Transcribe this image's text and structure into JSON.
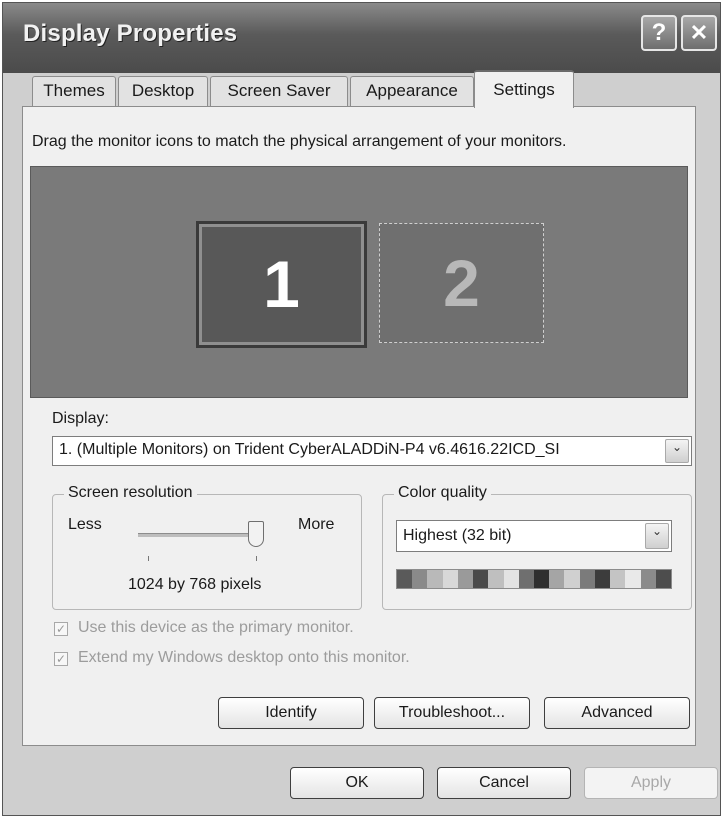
{
  "window": {
    "title": "Display Properties",
    "help_glyph": "?",
    "close_glyph": "✕"
  },
  "tabs": [
    {
      "label": "Themes"
    },
    {
      "label": "Desktop"
    },
    {
      "label": "Screen Saver"
    },
    {
      "label": "Appearance"
    },
    {
      "label": "Settings",
      "active": true
    }
  ],
  "settings": {
    "instruction": "Drag the monitor icons to match the physical arrangement of your monitors.",
    "monitors": [
      {
        "number": "1",
        "selected": true
      },
      {
        "number": "2",
        "selected": false
      }
    ],
    "display_label": "Display:",
    "display_value": "1. (Multiple Monitors) on Trident CyberALADDiN-P4  v6.4616.22ICD_SI",
    "resolution": {
      "group_label": "Screen resolution",
      "less_label": "Less",
      "more_label": "More",
      "value_text": "1024 by 768 pixels",
      "slider_fraction": 1.0
    },
    "color": {
      "group_label": "Color quality",
      "selected": "Highest (32 bit)",
      "swatches": [
        "#5a5a5a",
        "#8a8a8a",
        "#b9b9b9",
        "#d8d8d8",
        "#9a9a9a",
        "#4a4a4a",
        "#bfbfbf",
        "#e3e3e3",
        "#6f6f6f",
        "#2f2f2f",
        "#a5a5a5",
        "#d0d0d0",
        "#7b7b7b",
        "#3c3c3c",
        "#c4c4c4",
        "#e9e9e9",
        "#8b8b8b",
        "#4d4d4d"
      ]
    },
    "checkboxes": [
      {
        "label": "Use this device as the primary monitor.",
        "checked": true,
        "disabled": true
      },
      {
        "label": "Extend my Windows desktop onto this monitor.",
        "checked": true,
        "disabled": true
      }
    ],
    "buttons": {
      "identify": "Identify",
      "troubleshoot": "Troubleshoot...",
      "advanced": "Advanced"
    }
  },
  "footer": {
    "ok": "OK",
    "cancel": "Cancel",
    "apply": "Apply"
  },
  "glyphs": {
    "check": "✓",
    "dropdown": "⌄"
  }
}
